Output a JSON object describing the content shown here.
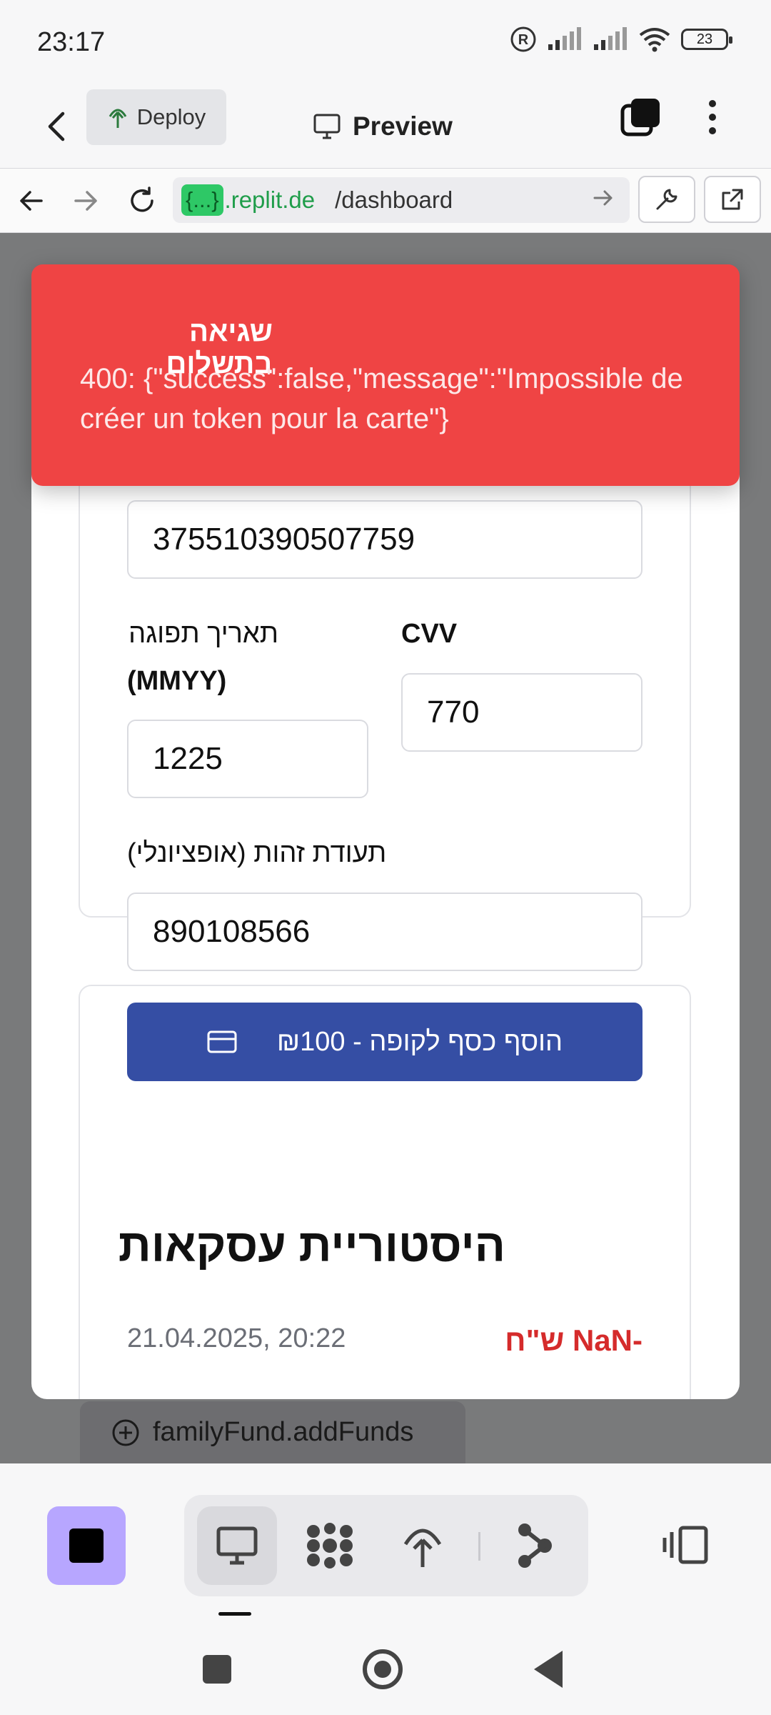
{
  "status": {
    "time": "23:17",
    "battery": "23"
  },
  "header": {
    "deploy_label": "Deploy",
    "preview_label": "Preview"
  },
  "browser": {
    "url_badge": "{...}",
    "url_domain": ".replit.de",
    "url_path": "/dashboard"
  },
  "toast": {
    "title": "שגיאה בתשלום",
    "message": "400: {\"success\":false,\"message\":\"Impossible de créer un token pour la carte\"}",
    "color": "#ef4444"
  },
  "payment": {
    "card_number": "375510390507759",
    "expiry_label": "תאריך תפוגה",
    "expiry_hint": "(MMYY)",
    "expiry_value": "1225",
    "cvv_label": "CVV",
    "cvv_value": "770",
    "id_label": "תעודת זהות (אופציונלי)",
    "id_value": "890108566",
    "submit_label": "הוסף כסף לקופה - ₪100",
    "submit_color": "#354ea4"
  },
  "history": {
    "title": "היסטוריית עסקאות",
    "rows": [
      {
        "date": "21.04.2025, 20:22",
        "amount": "-NaN ש\"ח"
      }
    ]
  },
  "behind": {
    "chip_label": "familyFund.addFunds"
  },
  "bottom_bar": {
    "accent": "#b7a6ff"
  }
}
